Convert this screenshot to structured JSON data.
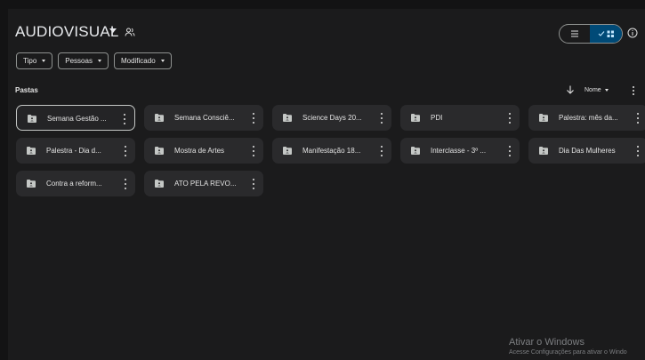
{
  "header": {
    "title": "AUDIOVISUAL",
    "title_caret_icon": "caret-down-icon",
    "share_icon": "people-icon",
    "view_toggle": {
      "list_icon": "list-view-icon",
      "grid_icon": "grid-view-icon",
      "check_icon": "check-icon",
      "selected": "grid"
    },
    "info_icon": "info-icon"
  },
  "filters": [
    {
      "label": "Tipo"
    },
    {
      "label": "Pessoas"
    },
    {
      "label": "Modificado"
    }
  ],
  "section": {
    "label": "Pastas"
  },
  "sort": {
    "label": "Nome",
    "direction_icon": "arrow-down-icon",
    "more_icon": "more-vert-icon"
  },
  "folders": [
    {
      "label": "Semana Gestão ...",
      "selected": true
    },
    {
      "label": "Semana Consciê..."
    },
    {
      "label": "Science Days 20..."
    },
    {
      "label": "PDI"
    },
    {
      "label": "Palestra: mês da..."
    },
    {
      "label": "Palestra - Dia d..."
    },
    {
      "label": "Mostra de Artes"
    },
    {
      "label": "Manifestação 18..."
    },
    {
      "label": "Interclasse - 3º ..."
    },
    {
      "label": "Dia Das Mulheres"
    },
    {
      "label": "Contra a reform..."
    },
    {
      "label": "ATO PELA REVO..."
    }
  ],
  "watermark": {
    "title": "Ativar o Windows",
    "subtitle": "Acesse Configurações para ativar o Windo"
  },
  "colors": {
    "background": "#131314",
    "card": "#2a2a2c",
    "accent": "#004a77",
    "text": "#e3e3e3"
  }
}
